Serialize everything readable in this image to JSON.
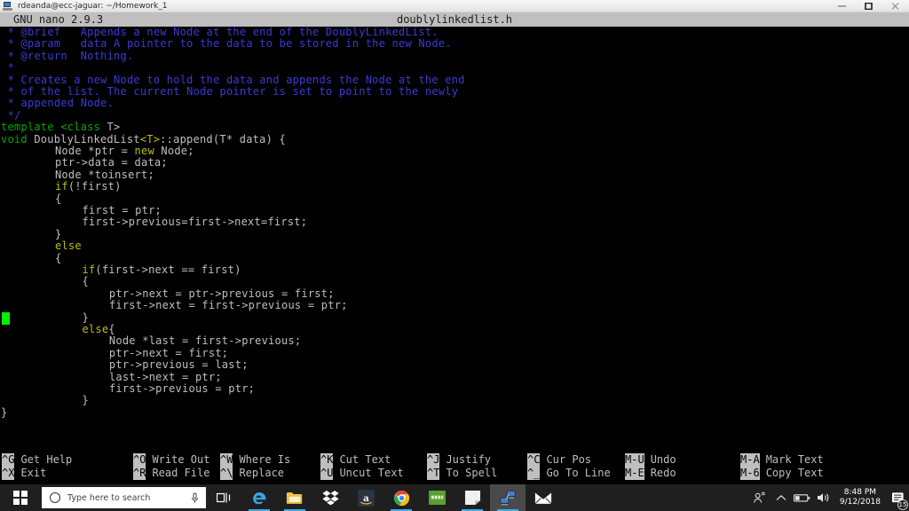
{
  "window": {
    "title": "rdeanda@ecc-jaguar: ~/Homework_1",
    "icon": "putty-icon",
    "minimize_label": "─",
    "maximize_label": "☐",
    "close_label": "✕"
  },
  "nano": {
    "version": "GNU nano 2.9.3",
    "filename": "doublylinkedlist.h",
    "cursor": {
      "line": 24,
      "column": 0
    },
    "lines": [
      {
        "indent": 1,
        "segments": [
          {
            "t": "* @brief   Appends a new Node at the end of the DoublyLinkedList.",
            "c": "comment"
          }
        ]
      },
      {
        "indent": 1,
        "segments": [
          {
            "t": "* @param   data A pointer to the data to be stored in the new Node.",
            "c": "comment"
          }
        ]
      },
      {
        "indent": 1,
        "segments": [
          {
            "t": "* @return  Nothing.",
            "c": "comment"
          }
        ]
      },
      {
        "indent": 1,
        "segments": [
          {
            "t": "*",
            "c": "comment"
          }
        ]
      },
      {
        "indent": 1,
        "segments": [
          {
            "t": "* Creates a new Node to hold the data and appends the Node at the end",
            "c": "comment"
          }
        ]
      },
      {
        "indent": 1,
        "segments": [
          {
            "t": "* of the list. The current Node pointer is set to point to the newly",
            "c": "comment"
          }
        ]
      },
      {
        "indent": 1,
        "segments": [
          {
            "t": "* appended Node.",
            "c": "comment"
          }
        ]
      },
      {
        "indent": 1,
        "segments": [
          {
            "t": "*/",
            "c": "comment"
          }
        ]
      },
      {
        "indent": 0,
        "segments": [
          {
            "t": "template ",
            "c": "green"
          },
          {
            "t": "<class",
            "c": "green"
          },
          {
            "t": " T>",
            "c": "plain"
          }
        ]
      },
      {
        "indent": 0,
        "segments": [
          {
            "t": "void",
            "c": "green"
          },
          {
            "t": " DoublyLinkedList",
            "c": "plain"
          },
          {
            "t": "<T>",
            "c": "yellow"
          },
          {
            "t": "::append(T* data) {",
            "c": "plain"
          }
        ]
      },
      {
        "indent": 8,
        "segments": [
          {
            "t": "Node *ptr = ",
            "c": "plain"
          },
          {
            "t": "new",
            "c": "yellow"
          },
          {
            "t": " Node;",
            "c": "plain"
          }
        ]
      },
      {
        "indent": 8,
        "segments": [
          {
            "t": "ptr->data = data;",
            "c": "plain"
          }
        ]
      },
      {
        "indent": 8,
        "segments": [
          {
            "t": "Node *toinsert;",
            "c": "plain"
          }
        ]
      },
      {
        "indent": 8,
        "segments": [
          {
            "t": "if",
            "c": "yellow"
          },
          {
            "t": "(!first)",
            "c": "plain"
          }
        ]
      },
      {
        "indent": 8,
        "segments": [
          {
            "t": "{",
            "c": "plain"
          }
        ]
      },
      {
        "indent": 12,
        "segments": [
          {
            "t": "first = ptr;",
            "c": "plain"
          }
        ]
      },
      {
        "indent": 12,
        "segments": [
          {
            "t": "first->previous=first->next=first;",
            "c": "plain"
          }
        ]
      },
      {
        "indent": 8,
        "segments": [
          {
            "t": "}",
            "c": "plain"
          }
        ]
      },
      {
        "indent": 8,
        "segments": [
          {
            "t": "else",
            "c": "yellow"
          }
        ]
      },
      {
        "indent": 8,
        "segments": [
          {
            "t": "{",
            "c": "plain"
          }
        ]
      },
      {
        "indent": 12,
        "segments": [
          {
            "t": "if",
            "c": "yellow"
          },
          {
            "t": "(first->next == first)",
            "c": "plain"
          }
        ]
      },
      {
        "indent": 12,
        "segments": [
          {
            "t": "{",
            "c": "plain"
          }
        ]
      },
      {
        "indent": 16,
        "segments": [
          {
            "t": "ptr->next = ptr->previous = first;",
            "c": "plain"
          }
        ]
      },
      {
        "indent": 16,
        "segments": [
          {
            "t": "first->next = first->previous = ptr;",
            "c": "plain"
          }
        ]
      },
      {
        "indent": 12,
        "segments": [
          {
            "t": "}",
            "c": "plain"
          }
        ]
      },
      {
        "indent": 12,
        "segments": [
          {
            "t": "else",
            "c": "yellow"
          },
          {
            "t": "{",
            "c": "plain"
          }
        ]
      },
      {
        "indent": 16,
        "segments": [
          {
            "t": "Node *last = first->previous;",
            "c": "plain"
          }
        ]
      },
      {
        "indent": 16,
        "segments": [
          {
            "t": "ptr->next = first;",
            "c": "plain"
          }
        ]
      },
      {
        "indent": 16,
        "segments": [
          {
            "t": "ptr->previous = last;",
            "c": "plain"
          }
        ]
      },
      {
        "indent": 16,
        "segments": [
          {
            "t": "last->next = ptr;",
            "c": "plain"
          }
        ]
      },
      {
        "indent": 16,
        "segments": [
          {
            "t": "first->previous = ptr;",
            "c": "plain"
          }
        ]
      },
      {
        "indent": 12,
        "segments": [
          {
            "t": "}",
            "c": "plain"
          }
        ]
      },
      {
        "indent": 0,
        "segments": [
          {
            "t": "}",
            "c": "plain"
          }
        ]
      }
    ],
    "shortcuts": [
      {
        "key": "^G",
        "label": "Get Help",
        "col": 0,
        "row": 0
      },
      {
        "key": "^X",
        "label": "Exit",
        "col": 0,
        "row": 1
      },
      {
        "key": "^O",
        "label": "Write Out",
        "col": 1,
        "row": 0
      },
      {
        "key": "^R",
        "label": "Read File",
        "col": 1,
        "row": 1
      },
      {
        "key": "^W",
        "label": "Where Is",
        "col": 2,
        "row": 0
      },
      {
        "key": "^\\",
        "label": "Replace",
        "col": 2,
        "row": 1
      },
      {
        "key": "^K",
        "label": "Cut Text",
        "col": 3,
        "row": 0
      },
      {
        "key": "^U",
        "label": "Uncut Text",
        "col": 3,
        "row": 1
      },
      {
        "key": "^J",
        "label": "Justify",
        "col": 4,
        "row": 0
      },
      {
        "key": "^T",
        "label": "To Spell",
        "col": 4,
        "row": 1
      },
      {
        "key": "^C",
        "label": "Cur Pos",
        "col": 5,
        "row": 0
      },
      {
        "key": "^_",
        "label": "Go To Line",
        "col": 5,
        "row": 1
      },
      {
        "key": "M-U",
        "label": "Undo",
        "col": 6,
        "row": 0
      },
      {
        "key": "M-E",
        "label": "Redo",
        "col": 6,
        "row": 1
      },
      {
        "key": "M-A",
        "label": "Mark Text",
        "col": 7,
        "row": 0
      },
      {
        "key": "M-6",
        "label": "Copy Text",
        "col": 7,
        "row": 1
      }
    ]
  },
  "taskbar": {
    "start": {
      "name": "start-button"
    },
    "search": {
      "placeholder": "Type here to search",
      "circle_icon": "cortana-circle-icon",
      "mic_icon": "microphone-icon"
    },
    "task_view": "task-view-icon",
    "apps": [
      {
        "name": "edge",
        "label": "Microsoft Edge",
        "color": "#3ba3e0",
        "running": true,
        "active": false
      },
      {
        "name": "explorer",
        "label": "File Explorer",
        "color": "#f3c44a",
        "running": true,
        "active": false
      },
      {
        "name": "dropbox",
        "label": "Dropbox",
        "color": "#ffffff",
        "running": false,
        "active": false
      },
      {
        "name": "amazon",
        "label": "Amazon",
        "color": "#2b3540",
        "running": false,
        "active": false
      },
      {
        "name": "chrome",
        "label": "Google Chrome",
        "color": "#4285f4",
        "running": true,
        "active": false
      },
      {
        "name": "green-app",
        "label": "Green App",
        "color": "#5aa032",
        "running": false,
        "active": false
      },
      {
        "name": "notes",
        "label": "Sticky Notes",
        "color": "#f0f0f0",
        "running": true,
        "active": false
      },
      {
        "name": "putty",
        "label": "PuTTY",
        "color": "#c8c8c8",
        "running": true,
        "active": true
      },
      {
        "name": "mail",
        "label": "Mail",
        "color": "#ffffff",
        "running": false,
        "active": false
      }
    ],
    "tray": {
      "people_icon": "people-icon",
      "chevron_icon": "show-hidden-icons-chevron",
      "battery_icon": "battery-icon",
      "volume_icon": "volume-icon",
      "time": "8:48 PM",
      "date": "9/12/2018",
      "notifications_icon": "action-center-icon",
      "notifications_count": "15"
    }
  }
}
